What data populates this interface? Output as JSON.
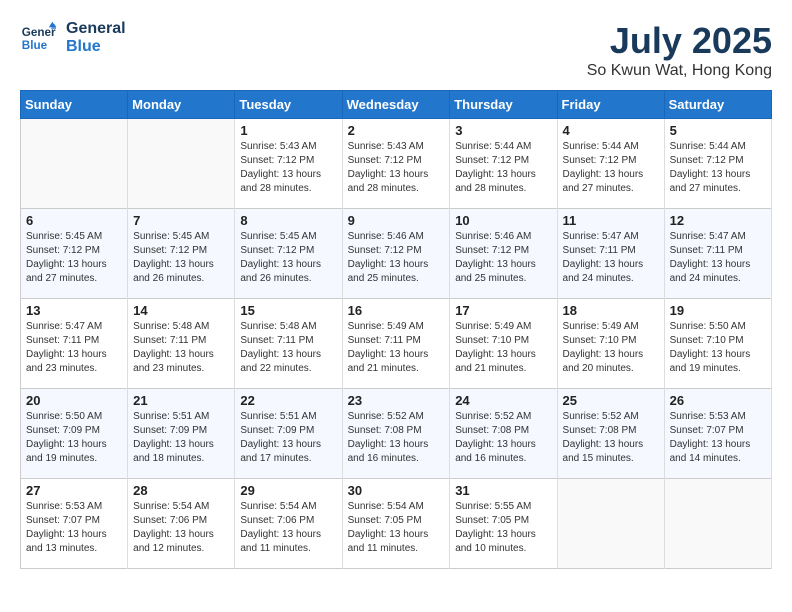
{
  "header": {
    "logo_line1": "General",
    "logo_line2": "Blue",
    "month": "July 2025",
    "location": "So Kwun Wat, Hong Kong"
  },
  "weekdays": [
    "Sunday",
    "Monday",
    "Tuesday",
    "Wednesday",
    "Thursday",
    "Friday",
    "Saturday"
  ],
  "weeks": [
    [
      {
        "day": "",
        "sunrise": "",
        "sunset": "",
        "daylight": ""
      },
      {
        "day": "",
        "sunrise": "",
        "sunset": "",
        "daylight": ""
      },
      {
        "day": "1",
        "sunrise": "Sunrise: 5:43 AM",
        "sunset": "Sunset: 7:12 PM",
        "daylight": "Daylight: 13 hours and 28 minutes."
      },
      {
        "day": "2",
        "sunrise": "Sunrise: 5:43 AM",
        "sunset": "Sunset: 7:12 PM",
        "daylight": "Daylight: 13 hours and 28 minutes."
      },
      {
        "day": "3",
        "sunrise": "Sunrise: 5:44 AM",
        "sunset": "Sunset: 7:12 PM",
        "daylight": "Daylight: 13 hours and 28 minutes."
      },
      {
        "day": "4",
        "sunrise": "Sunrise: 5:44 AM",
        "sunset": "Sunset: 7:12 PM",
        "daylight": "Daylight: 13 hours and 27 minutes."
      },
      {
        "day": "5",
        "sunrise": "Sunrise: 5:44 AM",
        "sunset": "Sunset: 7:12 PM",
        "daylight": "Daylight: 13 hours and 27 minutes."
      }
    ],
    [
      {
        "day": "6",
        "sunrise": "Sunrise: 5:45 AM",
        "sunset": "Sunset: 7:12 PM",
        "daylight": "Daylight: 13 hours and 27 minutes."
      },
      {
        "day": "7",
        "sunrise": "Sunrise: 5:45 AM",
        "sunset": "Sunset: 7:12 PM",
        "daylight": "Daylight: 13 hours and 26 minutes."
      },
      {
        "day": "8",
        "sunrise": "Sunrise: 5:45 AM",
        "sunset": "Sunset: 7:12 PM",
        "daylight": "Daylight: 13 hours and 26 minutes."
      },
      {
        "day": "9",
        "sunrise": "Sunrise: 5:46 AM",
        "sunset": "Sunset: 7:12 PM",
        "daylight": "Daylight: 13 hours and 25 minutes."
      },
      {
        "day": "10",
        "sunrise": "Sunrise: 5:46 AM",
        "sunset": "Sunset: 7:12 PM",
        "daylight": "Daylight: 13 hours and 25 minutes."
      },
      {
        "day": "11",
        "sunrise": "Sunrise: 5:47 AM",
        "sunset": "Sunset: 7:11 PM",
        "daylight": "Daylight: 13 hours and 24 minutes."
      },
      {
        "day": "12",
        "sunrise": "Sunrise: 5:47 AM",
        "sunset": "Sunset: 7:11 PM",
        "daylight": "Daylight: 13 hours and 24 minutes."
      }
    ],
    [
      {
        "day": "13",
        "sunrise": "Sunrise: 5:47 AM",
        "sunset": "Sunset: 7:11 PM",
        "daylight": "Daylight: 13 hours and 23 minutes."
      },
      {
        "day": "14",
        "sunrise": "Sunrise: 5:48 AM",
        "sunset": "Sunset: 7:11 PM",
        "daylight": "Daylight: 13 hours and 23 minutes."
      },
      {
        "day": "15",
        "sunrise": "Sunrise: 5:48 AM",
        "sunset": "Sunset: 7:11 PM",
        "daylight": "Daylight: 13 hours and 22 minutes."
      },
      {
        "day": "16",
        "sunrise": "Sunrise: 5:49 AM",
        "sunset": "Sunset: 7:11 PM",
        "daylight": "Daylight: 13 hours and 21 minutes."
      },
      {
        "day": "17",
        "sunrise": "Sunrise: 5:49 AM",
        "sunset": "Sunset: 7:10 PM",
        "daylight": "Daylight: 13 hours and 21 minutes."
      },
      {
        "day": "18",
        "sunrise": "Sunrise: 5:49 AM",
        "sunset": "Sunset: 7:10 PM",
        "daylight": "Daylight: 13 hours and 20 minutes."
      },
      {
        "day": "19",
        "sunrise": "Sunrise: 5:50 AM",
        "sunset": "Sunset: 7:10 PM",
        "daylight": "Daylight: 13 hours and 19 minutes."
      }
    ],
    [
      {
        "day": "20",
        "sunrise": "Sunrise: 5:50 AM",
        "sunset": "Sunset: 7:09 PM",
        "daylight": "Daylight: 13 hours and 19 minutes."
      },
      {
        "day": "21",
        "sunrise": "Sunrise: 5:51 AM",
        "sunset": "Sunset: 7:09 PM",
        "daylight": "Daylight: 13 hours and 18 minutes."
      },
      {
        "day": "22",
        "sunrise": "Sunrise: 5:51 AM",
        "sunset": "Sunset: 7:09 PM",
        "daylight": "Daylight: 13 hours and 17 minutes."
      },
      {
        "day": "23",
        "sunrise": "Sunrise: 5:52 AM",
        "sunset": "Sunset: 7:08 PM",
        "daylight": "Daylight: 13 hours and 16 minutes."
      },
      {
        "day": "24",
        "sunrise": "Sunrise: 5:52 AM",
        "sunset": "Sunset: 7:08 PM",
        "daylight": "Daylight: 13 hours and 16 minutes."
      },
      {
        "day": "25",
        "sunrise": "Sunrise: 5:52 AM",
        "sunset": "Sunset: 7:08 PM",
        "daylight": "Daylight: 13 hours and 15 minutes."
      },
      {
        "day": "26",
        "sunrise": "Sunrise: 5:53 AM",
        "sunset": "Sunset: 7:07 PM",
        "daylight": "Daylight: 13 hours and 14 minutes."
      }
    ],
    [
      {
        "day": "27",
        "sunrise": "Sunrise: 5:53 AM",
        "sunset": "Sunset: 7:07 PM",
        "daylight": "Daylight: 13 hours and 13 minutes."
      },
      {
        "day": "28",
        "sunrise": "Sunrise: 5:54 AM",
        "sunset": "Sunset: 7:06 PM",
        "daylight": "Daylight: 13 hours and 12 minutes."
      },
      {
        "day": "29",
        "sunrise": "Sunrise: 5:54 AM",
        "sunset": "Sunset: 7:06 PM",
        "daylight": "Daylight: 13 hours and 11 minutes."
      },
      {
        "day": "30",
        "sunrise": "Sunrise: 5:54 AM",
        "sunset": "Sunset: 7:05 PM",
        "daylight": "Daylight: 13 hours and 11 minutes."
      },
      {
        "day": "31",
        "sunrise": "Sunrise: 5:55 AM",
        "sunset": "Sunset: 7:05 PM",
        "daylight": "Daylight: 13 hours and 10 minutes."
      },
      {
        "day": "",
        "sunrise": "",
        "sunset": "",
        "daylight": ""
      },
      {
        "day": "",
        "sunrise": "",
        "sunset": "",
        "daylight": ""
      }
    ]
  ]
}
